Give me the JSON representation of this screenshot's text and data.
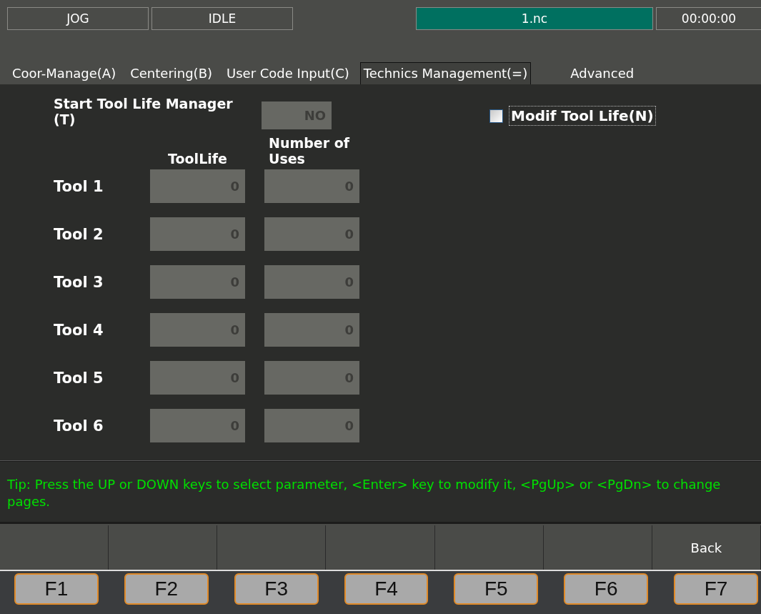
{
  "status_bar": [
    {
      "kind": "plain",
      "text": "JOG"
    },
    {
      "kind": "plain",
      "text": "IDLE"
    },
    {
      "kind": "spacer"
    },
    {
      "kind": "file",
      "text": "1.nc"
    },
    {
      "kind": "plain",
      "text": "00:00:00"
    }
  ],
  "tabs": [
    {
      "label": "Coor-Manage(A)",
      "selected": false
    },
    {
      "label": "Centering(B)",
      "selected": false
    },
    {
      "label": "User Code Input(C)",
      "selected": false
    },
    {
      "label": "Technics Management(=)",
      "selected": true
    },
    {
      "label": "Advanced",
      "selected": false
    }
  ],
  "start_manager": {
    "label": "Start Tool Life Manager (T)",
    "value": "NO"
  },
  "columns": [
    "ToolLife",
    "Number of Uses"
  ],
  "tools": [
    {
      "name": "Tool 1",
      "tool_life": "0",
      "uses": "0"
    },
    {
      "name": "Tool 2",
      "tool_life": "0",
      "uses": "0"
    },
    {
      "name": "Tool 3",
      "tool_life": "0",
      "uses": "0"
    },
    {
      "name": "Tool 4",
      "tool_life": "0",
      "uses": "0"
    },
    {
      "name": "Tool 5",
      "tool_life": "0",
      "uses": "0"
    },
    {
      "name": "Tool 6",
      "tool_life": "0",
      "uses": "0"
    }
  ],
  "modify_tool_life": {
    "label": "Modif Tool Life(N)",
    "checked": false
  },
  "tip": "Tip: Press the UP or DOWN keys to select parameter, <Enter> key to modify it, <PgUp> or <PgDn> to change pages.",
  "softkeys": [
    {
      "kind": "blank"
    },
    {
      "kind": "blank"
    },
    {
      "kind": "blank"
    },
    {
      "kind": "blank"
    },
    {
      "kind": "blank"
    },
    {
      "kind": "blank"
    },
    {
      "kind": "label",
      "label": "Back"
    }
  ],
  "function_keys": [
    "F1",
    "F2",
    "F3",
    "F4",
    "F5",
    "F6",
    "F7"
  ]
}
